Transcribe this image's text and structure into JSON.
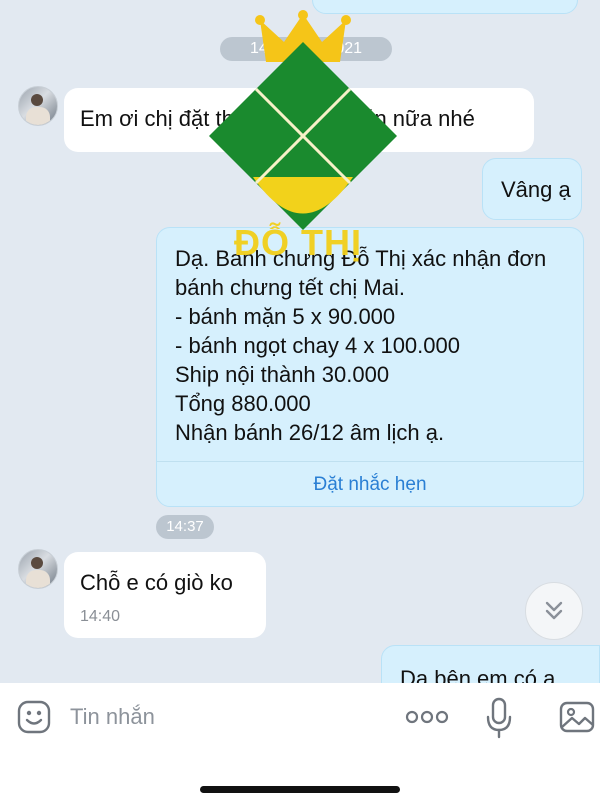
{
  "timestamps": {
    "header": "14:27 · 01/2021",
    "after_confirmation": "14:37"
  },
  "messages": [
    {
      "sender": "other",
      "text": "Em ơi chị đặt thêm 2 bánh mặn nữa nhé"
    },
    {
      "sender": "me",
      "text": "Vâng ạ"
    },
    {
      "sender": "me",
      "lines": [
        "Dạ. Banh chưng Đỗ Thị xác nhận đơn",
        "bánh chưng tết chị Mai.",
        "- bánh mặn 5 x 90.000",
        "- bánh ngọt chay 4 x 100.000",
        "Ship nội thành 30.000",
        "Tổng 880.000",
        "Nhận bánh 26/12 âm lịch ạ."
      ],
      "action": "Đặt nhắc hẹn"
    },
    {
      "sender": "other",
      "text": "Chỗ e có giò ko",
      "time": "14:40"
    },
    {
      "sender": "me",
      "text": "Dạ bên em có ạ."
    }
  ],
  "watermark": {
    "text": "ĐỖ THỊ",
    "colors": {
      "green": "#1a8a2e",
      "yellow": "#f2d21b",
      "crown": "#f5c518"
    }
  },
  "composer": {
    "placeholder": "Tin nhắn",
    "icons": [
      "emoji-icon",
      "more-icon",
      "microphone-icon",
      "gallery-icon"
    ]
  },
  "colors": {
    "background": "#e2e9f1",
    "outgoing": "#d6f0fd",
    "incoming": "#ffffff",
    "link": "#2a7fd4"
  }
}
